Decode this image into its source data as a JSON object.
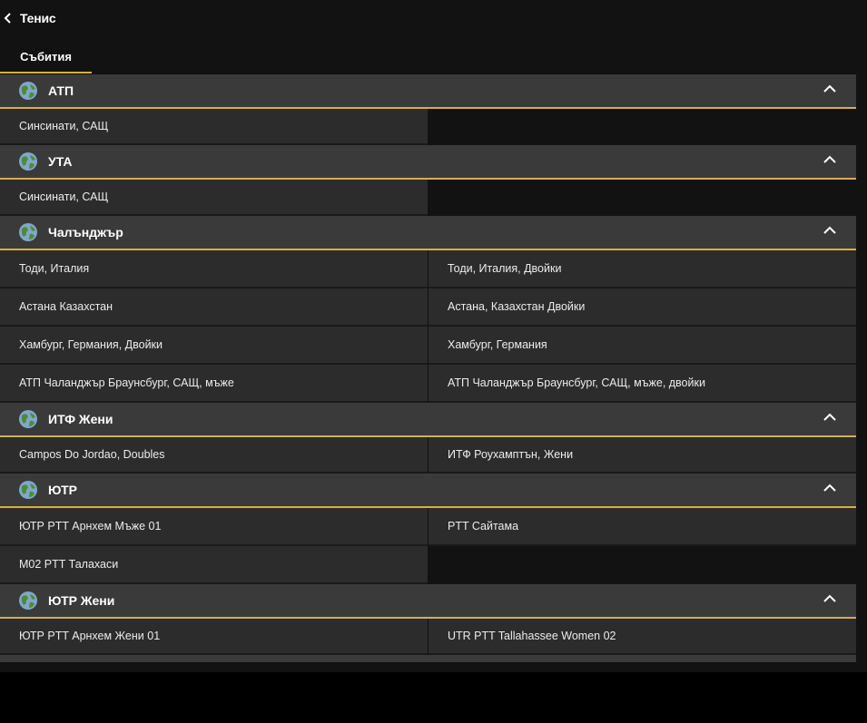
{
  "header": {
    "back_icon": "chevron-left-icon",
    "title": "Тенис"
  },
  "tabs": [
    {
      "label": "Събития",
      "active": true
    }
  ],
  "colors": {
    "accent": "#d4b04a",
    "header_bg": "#3a3a3a",
    "row_bg": "#2c2c2c",
    "page_bg": "#121212"
  },
  "groups": [
    {
      "name": "АТП",
      "icon": "globe-icon",
      "expanded": true,
      "events": [
        "Синсинати, САЩ"
      ]
    },
    {
      "name": "УТА",
      "icon": "globe-icon",
      "expanded": true,
      "events": [
        "Синсинати, САЩ"
      ]
    },
    {
      "name": "Чалънджър",
      "icon": "globe-icon",
      "expanded": true,
      "events": [
        "Тоди, Италия",
        "Тоди, Италия, Двойки",
        "Астана Казахстан",
        "Астана, Казахстан Двойки",
        "Хамбург, Германия, Двойки",
        "Хамбург, Германия",
        "АТП Чаланджър Браунсбург, САЩ, мъже",
        "АТП Чаланджър Браунсбург, САЩ, мъже, двойки"
      ]
    },
    {
      "name": "ИТФ Жени",
      "icon": "globe-icon",
      "expanded": true,
      "events": [
        "Campos Do Jordao, Doubles",
        "ИТФ Роухамптън, Жени"
      ]
    },
    {
      "name": "ЮТР",
      "icon": "globe-icon",
      "expanded": true,
      "events": [
        "ЮТР PTT Арнхем Мъже 01",
        "PTT Сайтама",
        "M02 PTT Талахаси"
      ]
    },
    {
      "name": "ЮТР Жени",
      "icon": "globe-icon",
      "expanded": true,
      "events": [
        "ЮТР PTT Арнхем Жени 01",
        "UTR PTT Tallahassee Women 02"
      ]
    }
  ]
}
